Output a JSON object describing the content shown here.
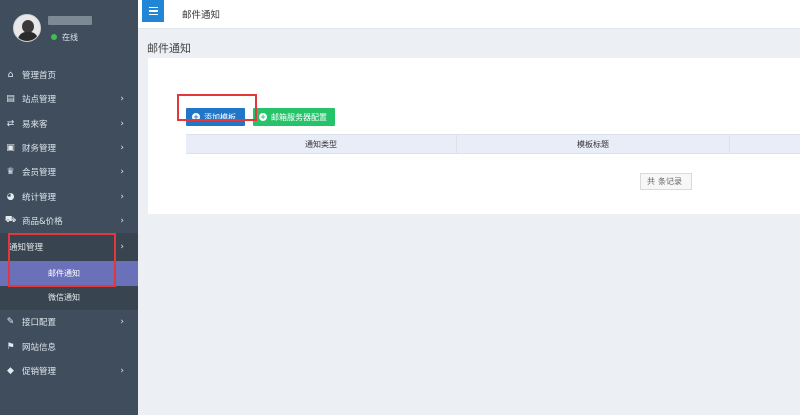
{
  "user": {
    "status": "在线"
  },
  "topbar": {
    "title": "邮件通知"
  },
  "page": {
    "title": "邮件通知"
  },
  "buttons": {
    "add_template": "添加模板",
    "smtp_config": "邮箱服务器配置"
  },
  "table": {
    "headers": [
      "通知类型",
      "模板标题",
      ""
    ]
  },
  "pagination": {
    "total_prefix": "共",
    "total_suffix": "条记录"
  },
  "sidebar": {
    "items": [
      {
        "label": "管理首页",
        "icon": "home-icon",
        "chevron": false
      },
      {
        "label": "站点管理",
        "icon": "database-icon",
        "chevron": true
      },
      {
        "label": "易来客",
        "icon": "shuffle-icon",
        "chevron": true
      },
      {
        "label": "财务管理",
        "icon": "wallet-icon",
        "chevron": true
      },
      {
        "label": "会员管理",
        "icon": "crown-icon",
        "chevron": true
      },
      {
        "label": "统计管理",
        "icon": "pie-chart-icon",
        "chevron": true
      },
      {
        "label": "商品&价格",
        "icon": "cart-icon",
        "chevron": true
      },
      {
        "label": "通知管理",
        "icon": "",
        "chevron": true
      },
      {
        "label": "接口配置",
        "icon": "plug-icon",
        "chevron": true
      },
      {
        "label": "网站信息",
        "icon": "flag-icon",
        "chevron": false
      },
      {
        "label": "促销管理",
        "icon": "tag-icon",
        "chevron": true
      }
    ],
    "submenu": [
      {
        "label": "邮件通知",
        "active": true
      },
      {
        "label": "微信通知",
        "active": false
      }
    ]
  },
  "colors": {
    "sidebar_bg": "#3f4d5c",
    "active_bg": "#6a71b9",
    "primary": "#2176c7",
    "success": "#27c36b",
    "highlight_border": "#e0383b"
  }
}
